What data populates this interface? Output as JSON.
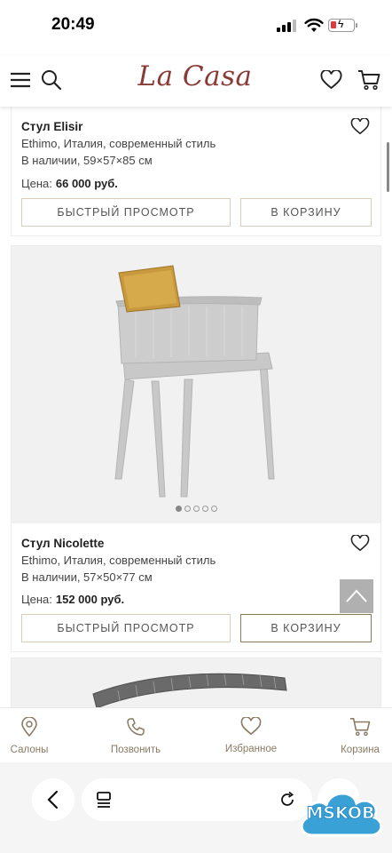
{
  "status_bar": {
    "time": "20:49"
  },
  "header": {
    "logo": "La Casa"
  },
  "products": [
    {
      "name": "Стул Elisir",
      "line1": "Ethimo, Италия, современный стиль",
      "line2": "В наличии, 59×57×85 см",
      "price_label": "Цена:",
      "price": "66 000 руб.",
      "quick_view": "БЫСТРЫЙ ПРОСМОТР",
      "to_cart": "В КОРЗИНУ"
    },
    {
      "name": "Стул Nicolette",
      "line1": "Ethimo, Италия, современный стиль",
      "line2": "В наличии, 57×50×77 см",
      "price_label": "Цена:",
      "price": "152 000 руб.",
      "quick_view": "БЫСТРЫЙ ПРОСМОТР",
      "to_cart": "В КОРЗИНУ",
      "carousel": {
        "count": 5,
        "active": 1
      }
    }
  ],
  "bottom_nav": [
    {
      "label": "Салоны",
      "icon": "location-pin-icon"
    },
    {
      "label": "Позвонить",
      "icon": "phone-icon"
    },
    {
      "label": "Избранное",
      "icon": "heart-icon"
    },
    {
      "label": "Корзина",
      "icon": "cart-icon"
    }
  ],
  "watermark": "MSKOB",
  "colors": {
    "brand": "#8a3a34",
    "accent": "#8a7a62",
    "button_border": "#d9cdb9"
  }
}
